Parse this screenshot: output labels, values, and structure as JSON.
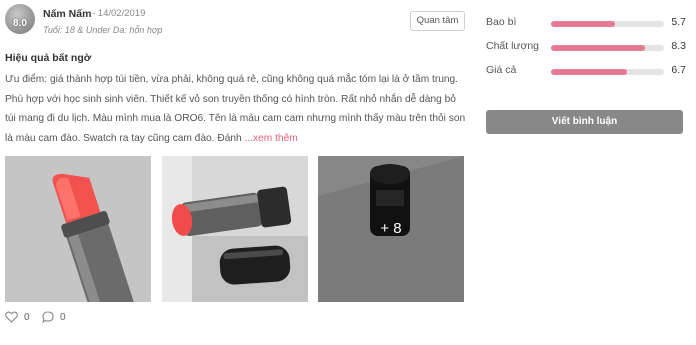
{
  "review": {
    "user": {
      "name": "Nấm Nấm",
      "date": "- 14/02/2019",
      "avatar_score": "8.0",
      "meta": "Tuổi: 18 & Under  Da: hỗn hợp"
    },
    "follow_label": "Quan tâm",
    "title": "Hiệu quả bất ngờ",
    "body": "Ưu điểm: giá thành hợp túi tiền, vừa phải, không quá rẻ, cũng không quá mắc tóm lại là ở tầm trung. Phù hợp với học sinh sinh viên. Thiết kế vỏ son truyền thống có hình tròn. Rất nhỏ nhắn dễ dàng bỏ túi mang đi du lịch. Màu mình mua là ORO6. Tên là màu cam cam nhưng mình thấy màu trên thỏi son là màu cam đào. Swatch ra tay cũng cam đào. Đánh ",
    "read_more": "...xem thêm",
    "photos": [
      "lipstick-photo",
      "lipstick-photo",
      "lipstick-photo"
    ],
    "more_photos": "+ 8",
    "likes": "0",
    "comments": "0"
  },
  "ratings": [
    {
      "label": "Bao bì",
      "value": "5.7",
      "score": 5.7
    },
    {
      "label": "Chất lượng",
      "value": "8.3",
      "score": 8.3
    },
    {
      "label": "Giá cả",
      "value": "6.7",
      "score": 6.7
    }
  ],
  "rating_max": 10,
  "write_review_label": "Viết bình luận",
  "colors": {
    "accent": "#e87b94",
    "read_more": "#e0607e",
    "button_bg": "#888888"
  }
}
